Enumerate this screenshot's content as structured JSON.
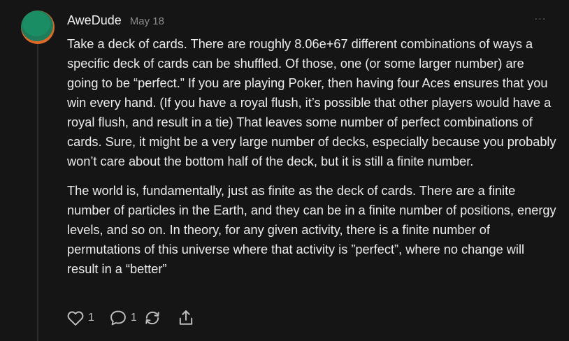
{
  "post": {
    "username": "AweDude",
    "date": "May 18",
    "more_icon": "more-icon",
    "more_glyph": "···",
    "paragraphs": [
      "Take a deck of cards. There are roughly 8.06e+67 different combinations of ways a specific deck of cards can be shuffled. Of those, one (or some larger number) are going to be “perfect.” If you are playing Poker, then having four Aces ensures that you win every hand. (If you have a royal flush, it’s possible that other players would have a royal flush, and result in a tie) That leaves some number of perfect combinations of cards. Sure, it might be a very large number of decks, especially because you probably won’t care about the bottom half of the deck, but it is still a finite number.",
      "The world is, fundamentally, just as finite as the deck of cards. There are a finite number of particles in the Earth, and they can be in a finite number of positions, energy levels, and so on. In theory, for any given activity, there is a finite number of permutations of this universe where that activity is ”perfect”, where no change will result in a “better”"
    ],
    "actions": {
      "like": {
        "icon": "heart-icon",
        "count": "1"
      },
      "comment": {
        "icon": "comment-icon",
        "count": "1"
      },
      "restack": {
        "icon": "restack-icon"
      },
      "share": {
        "icon": "share-icon"
      }
    }
  },
  "colors": {
    "background": "#151515",
    "text": "#ececec",
    "muted": "#8a8a8a",
    "avatar_orange": "#e06a25",
    "avatar_green": "#1b8d64"
  }
}
